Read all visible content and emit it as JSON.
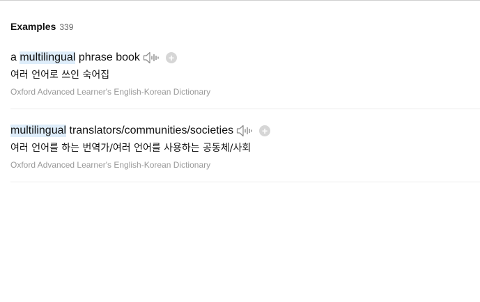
{
  "examples": {
    "title": "Examples",
    "count": "339",
    "items": [
      {
        "en_parts": [
          {
            "text": "a ",
            "highlight": false
          },
          {
            "text": "multilingual",
            "highlight": true
          },
          {
            "text": " phrase book",
            "highlight": false
          }
        ],
        "ko": "여러 언어로 쓰인 숙어집",
        "source": "Oxford Advanced Learner's English-Korean Dictionary"
      },
      {
        "en_parts": [
          {
            "text": "multilingual",
            "highlight": true
          },
          {
            "text": " translators/communities/societies",
            "highlight": false
          }
        ],
        "ko": "여러 언어를 하는 번역가/여러 언어를 사용하는 공동체/사회",
        "source": "Oxford Advanced Learner's English-Korean Dictionary"
      }
    ]
  },
  "icons": {
    "speaker": "speaker-icon",
    "add": "plus-icon",
    "add_glyph": "+"
  },
  "colors": {
    "highlight": "#deedfa",
    "source_text": "#999999",
    "add_button": "#d6d6d6"
  }
}
